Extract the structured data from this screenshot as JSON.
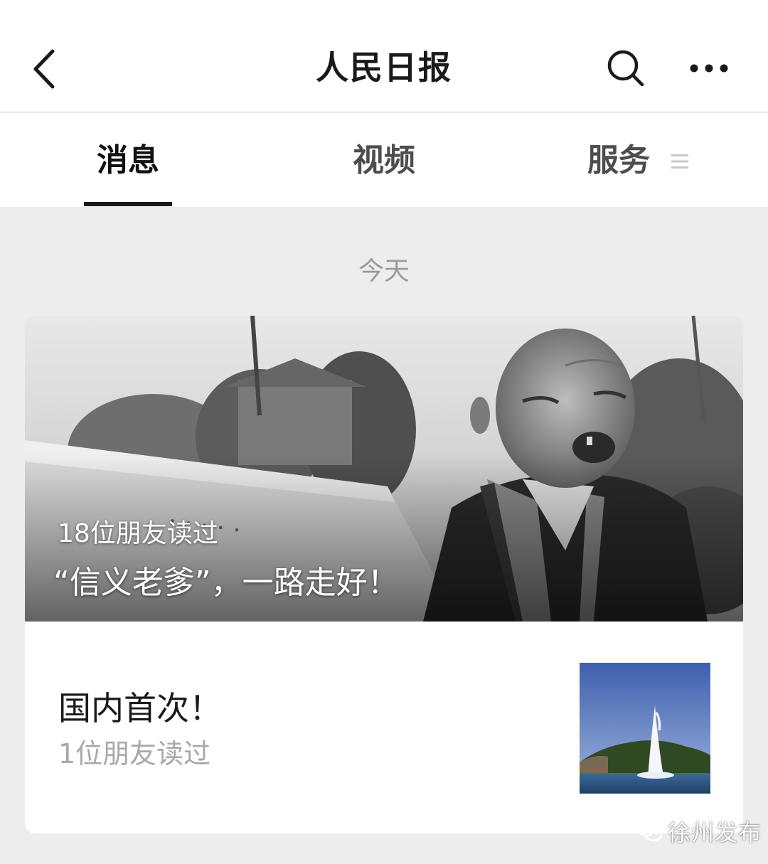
{
  "header": {
    "title": "人民日报",
    "icons": [
      "back-arrow-icon",
      "search-icon",
      "more-icon"
    ]
  },
  "tabs": [
    {
      "label": "消息",
      "active": true
    },
    {
      "label": "视频",
      "active": false
    },
    {
      "label": "服务",
      "active": false,
      "icon": "menu-icon"
    }
  ],
  "feed": {
    "date_label": "今天",
    "cover_article": {
      "readers": "18位朋友读过",
      "title": "“信义老爹”，一路走好！"
    },
    "article": {
      "title": "国内首次！",
      "readers": "1位朋友读过"
    }
  },
  "watermark": {
    "text": "徐州发布",
    "icon": "wechat-logo-icon"
  },
  "colors": {
    "background": "#ededed",
    "card": "#ffffff",
    "text_primary": "#1a1a1a",
    "text_secondary": "#a8a8a8"
  }
}
